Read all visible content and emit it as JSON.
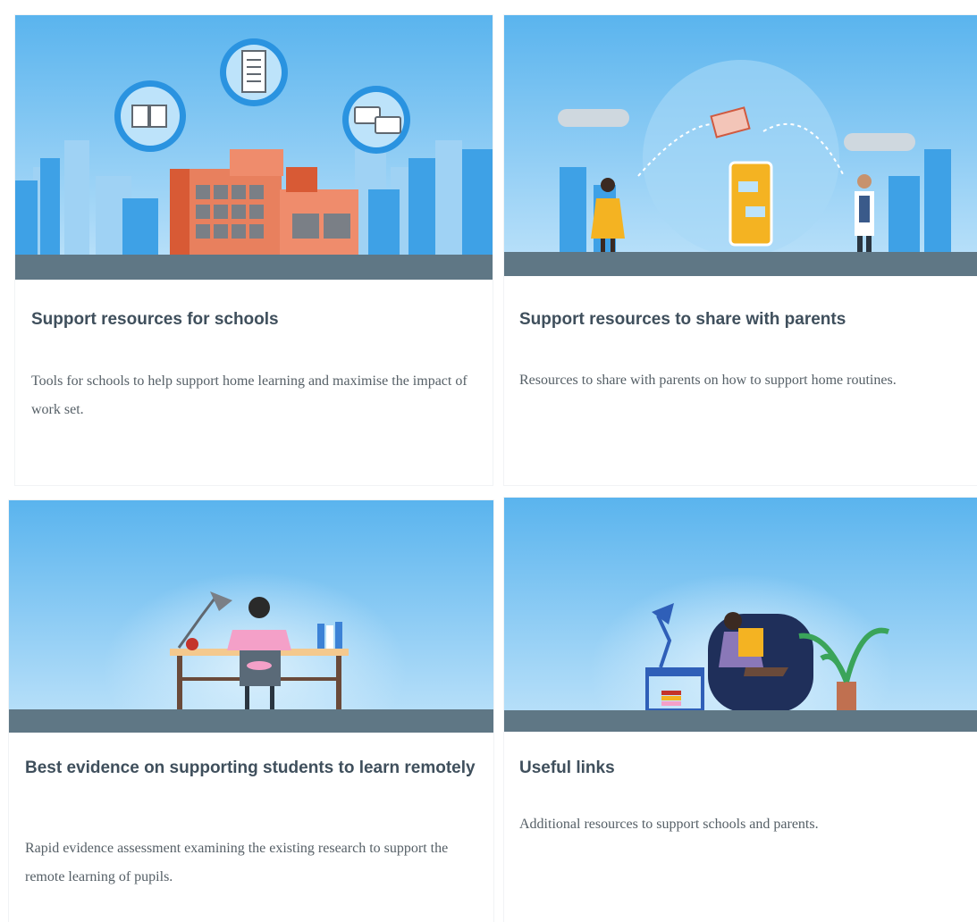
{
  "cards": [
    {
      "title": "Support resources for schools",
      "description": "Tools for schools to help support home learning and maximise the impact of work set.",
      "illustration": "school-building-with-book-notebook-chat-icons"
    },
    {
      "title": "Support resources to share with parents",
      "description": "Resources to share with parents on how to support home routines.",
      "illustration": "parent-and-child-with-phone-and-envelope"
    },
    {
      "title": "Best evidence on supporting students to learn remotely",
      "description": "Rapid evidence assessment examining the existing research to support the remote learning of pupils.",
      "illustration": "student-at-desk-with-lamp"
    },
    {
      "title": "Useful links",
      "description": "Additional resources to support schools and parents.",
      "illustration": "child-reading-in-armchair-with-plant"
    }
  ],
  "colors": {
    "sky_top": "#5fb6ee",
    "sky_bottom": "#bfe3fa",
    "ground": "#5f7785",
    "heading": "#3f4f5c",
    "body_text": "#555f66"
  }
}
